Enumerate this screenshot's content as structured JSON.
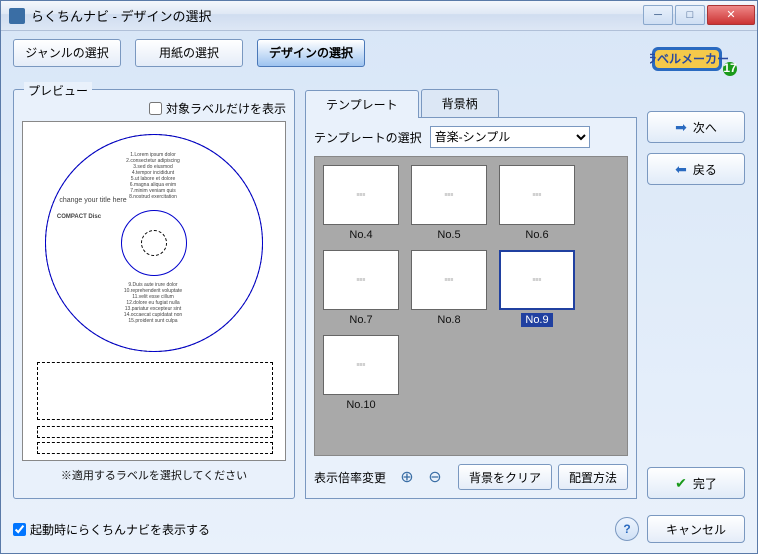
{
  "window": {
    "title": "らくちんナビ - デザインの選択"
  },
  "steps": {
    "genre": "ジャンルの選択",
    "paper": "用紙の選択",
    "design": "デザインの選択"
  },
  "preview": {
    "legend": "プレビュー",
    "target_label": "対象ラベルだけを表示",
    "note": "※適用するラベルを選択してください",
    "disc_title": "change your title here",
    "disc_brand": "COMPACT Disc"
  },
  "subtabs": {
    "template": "テンプレート",
    "background": "背景柄"
  },
  "template_panel": {
    "select_label": "テンプレートの選択",
    "select_value": "音楽-シンプル",
    "thumbs": [
      {
        "label": "No.4"
      },
      {
        "label": "No.5"
      },
      {
        "label": "No.6"
      },
      {
        "label": "No.7"
      },
      {
        "label": "No.8"
      },
      {
        "label": "No.9",
        "selected": true
      },
      {
        "label": "No.10"
      }
    ],
    "zoom_label": "表示倍率変更",
    "clear_bg": "背景をクリア",
    "layout": "配置方法"
  },
  "side": {
    "next": "次へ",
    "back": "戻る",
    "finish": "完了"
  },
  "footer": {
    "startup_label": "起動時にらくちんナビを表示する",
    "cancel": "キャンセル"
  }
}
